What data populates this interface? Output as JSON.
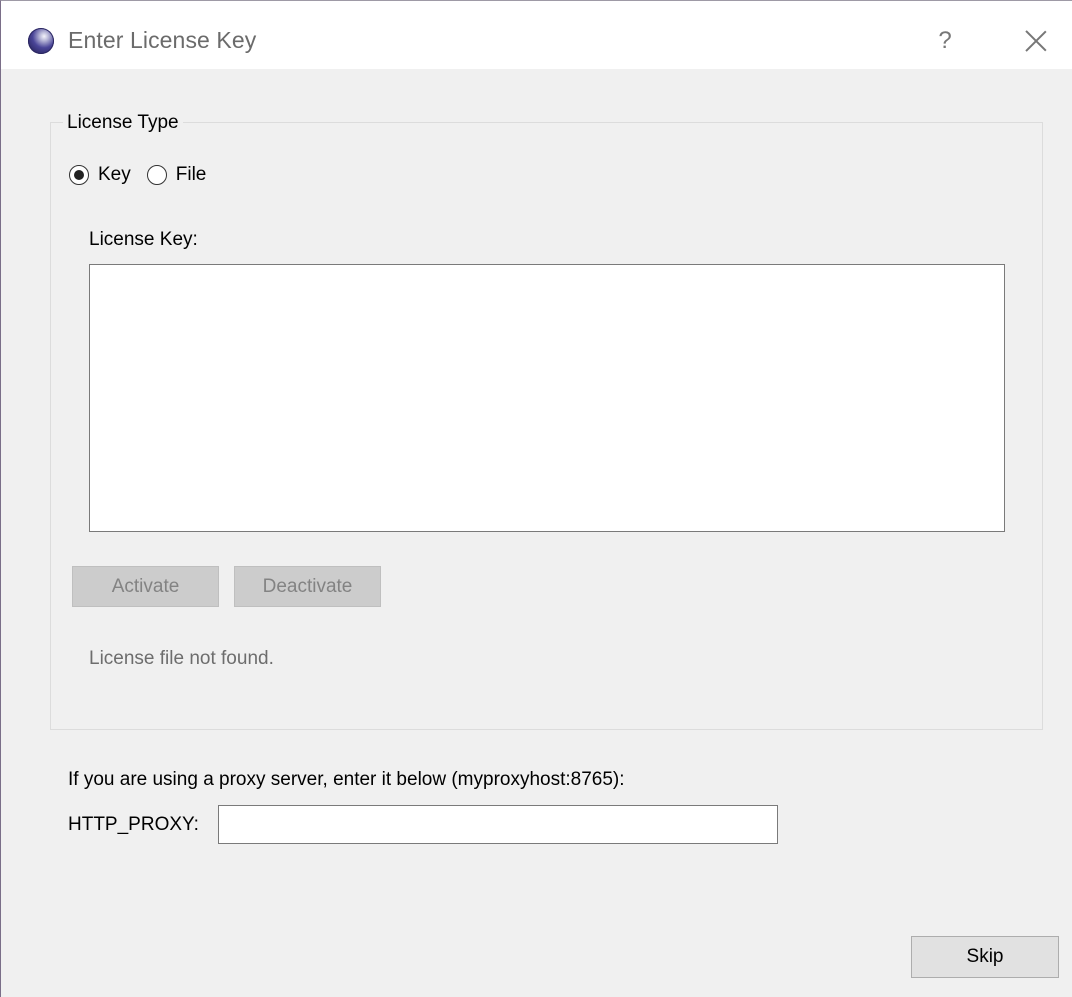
{
  "window": {
    "title": "Enter License Key",
    "help_label": "?",
    "close_icon": "close-icon"
  },
  "license_type": {
    "group_title": "License Type",
    "options": [
      {
        "label": "Key",
        "checked": true
      },
      {
        "label": "File",
        "checked": false
      }
    ]
  },
  "license_key": {
    "label": "License Key:",
    "value": ""
  },
  "buttons": {
    "activate_label": "Activate",
    "deactivate_label": "Deactivate",
    "skip_label": "Skip"
  },
  "status": {
    "message": "License file not found."
  },
  "proxy": {
    "hint": "If you are using a proxy server, enter it below (myproxyhost:8765):",
    "label": "HTTP_PROXY:",
    "value": ""
  },
  "colors": {
    "window_bg": "#f0f0f0",
    "titlebar_bg": "#ffffff",
    "disabled_button_bg": "#cccccc",
    "disabled_text": "#838383"
  }
}
